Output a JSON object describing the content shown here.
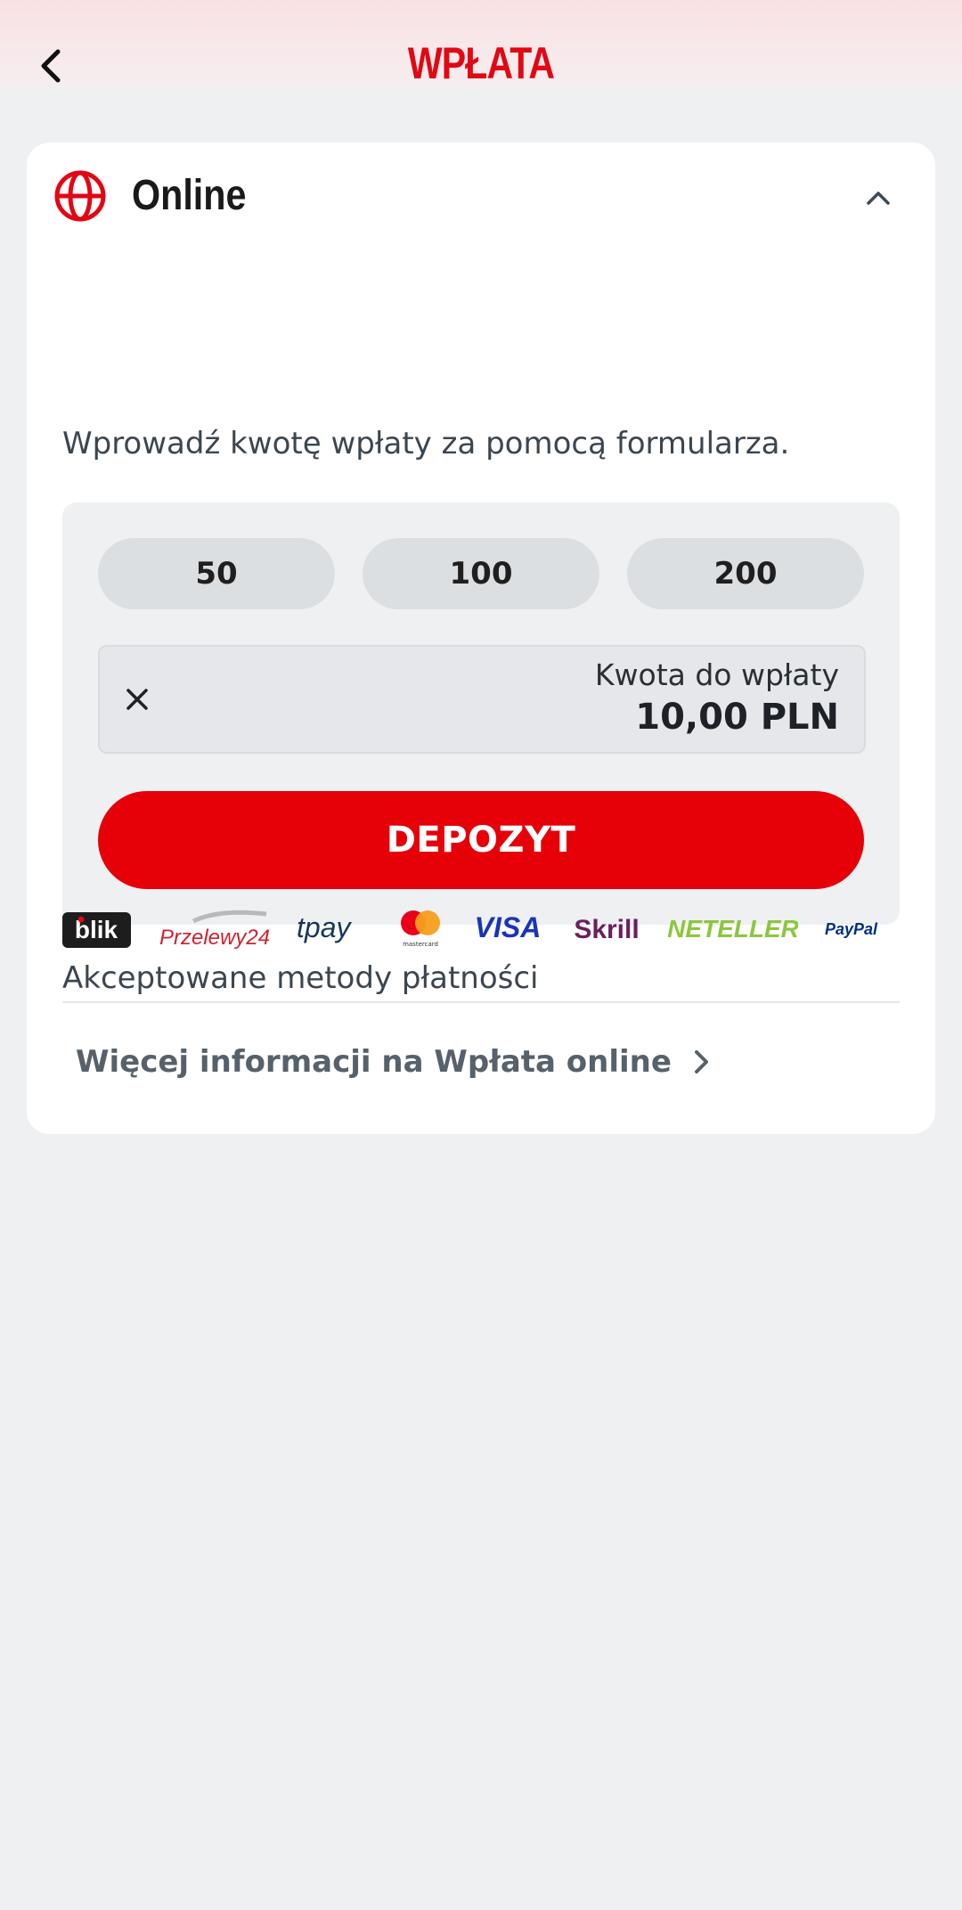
{
  "header": {
    "title": "WPŁATA",
    "back_icon": "chevron-left-icon"
  },
  "section": {
    "icon": "globe-icon",
    "title": "Online",
    "collapse_icon": "chevron-up-icon",
    "expanded": true,
    "description": "Wprowadź kwotę wpłaty za pomocą formularza."
  },
  "form": {
    "quick_amounts": [
      "50",
      "100",
      "200"
    ],
    "amount_label": "Kwota do wpłaty",
    "amount_value": "10,00 PLN",
    "clear_icon": "close-icon",
    "deposit_label": "DEPOZYT"
  },
  "payment_methods": {
    "label": "Akceptowane metody płatności",
    "logos": [
      "blik",
      "Przelewy24",
      "tpay",
      "mastercard",
      "VISA",
      "Skrill",
      "NETELLER",
      "PayPal"
    ]
  },
  "more_info": {
    "label": "Więcej informacji na Wpłata online",
    "icon": "chevron-right-icon"
  },
  "colors": {
    "brand_red": "#e30613",
    "button_red": "#e60008",
    "background": "#eff0f2",
    "card": "#ffffff",
    "chip": "#dcdfe2",
    "link_gray": "#56616b"
  }
}
